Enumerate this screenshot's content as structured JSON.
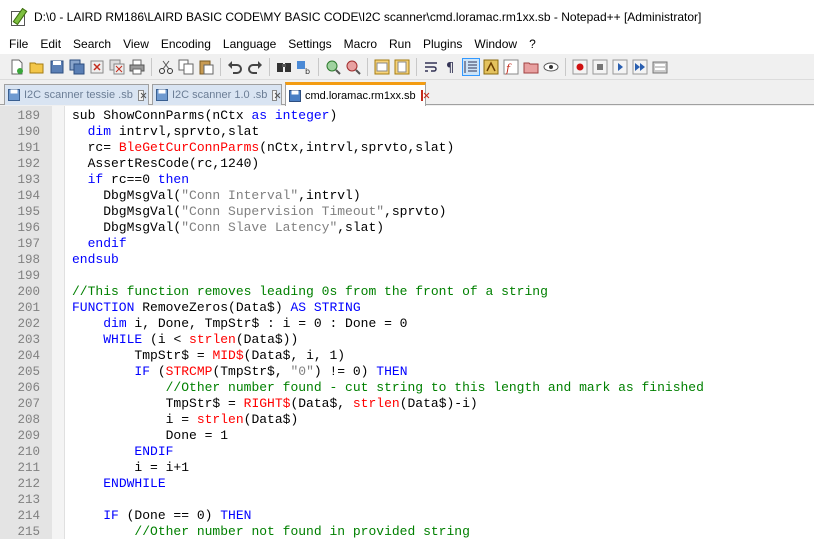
{
  "window": {
    "title": "D:\\0 - LAIRD RM186\\LAIRD BASIC CODE\\MY BASIC CODE\\I2C scanner\\cmd.loramac.rm1xx.sb - Notepad++ [Administrator]"
  },
  "menu": [
    "File",
    "Edit",
    "Search",
    "View",
    "Encoding",
    "Language",
    "Settings",
    "Macro",
    "Run",
    "Plugins",
    "Window",
    "?"
  ],
  "toolbar": {
    "icons": [
      "new-file-icon",
      "open-file-icon",
      "save-icon",
      "save-all-icon",
      "close-icon",
      "close-all-icon",
      "print-icon",
      "cut-icon",
      "copy-icon",
      "paste-icon",
      "undo-icon",
      "redo-icon",
      "find-icon",
      "replace-icon",
      "zoom-in-icon",
      "zoom-out-icon",
      "sync-vertical-icon",
      "sync-horizontal-icon",
      "word-wrap-icon",
      "show-all-characters-icon",
      "indent-guide-icon",
      "user-defined-language-icon",
      "function-list-icon",
      "folder-as-workspace-icon",
      "document-map-icon",
      "monitoring-icon",
      "record-macro-icon",
      "stop-recording-icon",
      "play-macro-icon",
      "run-macro-multiple-icon",
      "save-macro-icon"
    ]
  },
  "tabs": [
    {
      "label": "I2C scanner tessie .sb",
      "active": false
    },
    {
      "label": "I2C scanner 1.0 .sb",
      "active": false
    },
    {
      "label": "cmd.loramac.rm1xx.sb",
      "active": true
    }
  ],
  "editor": {
    "lines": [
      {
        "n": "189",
        "segs": [
          [
            "",
            "sub ShowConnParms(nCtx "
          ],
          [
            "kw",
            "as"
          ],
          [
            "",
            " "
          ],
          [
            "kw",
            "integer"
          ],
          [
            "",
            ")"
          ]
        ]
      },
      {
        "n": "190",
        "segs": [
          [
            "",
            "  "
          ],
          [
            "kw",
            "dim"
          ],
          [
            "",
            " intrvl,sprvto,slat"
          ]
        ]
      },
      {
        "n": "191",
        "segs": [
          [
            "",
            "  rc= "
          ],
          [
            "fn",
            "BleGetCurConnParms"
          ],
          [
            "",
            "(nCtx,intrvl,sprvto,slat)"
          ]
        ]
      },
      {
        "n": "192",
        "segs": [
          [
            "",
            "  AssertResCode(rc,1240)"
          ]
        ]
      },
      {
        "n": "193",
        "segs": [
          [
            "",
            "  "
          ],
          [
            "kw",
            "if"
          ],
          [
            "",
            " rc==0 "
          ],
          [
            "kw",
            "then"
          ]
        ]
      },
      {
        "n": "194",
        "segs": [
          [
            "",
            "    DbgMsgVal("
          ],
          [
            "str",
            "\"Conn Interval\""
          ],
          [
            "",
            ",intrvl)"
          ]
        ]
      },
      {
        "n": "195",
        "segs": [
          [
            "",
            "    DbgMsgVal("
          ],
          [
            "str",
            "\"Conn Supervision Timeout\""
          ],
          [
            "",
            ",sprvto)"
          ]
        ]
      },
      {
        "n": "196",
        "segs": [
          [
            "",
            "    DbgMsgVal("
          ],
          [
            "str",
            "\"Conn Slave Latency\""
          ],
          [
            "",
            ",slat)"
          ]
        ]
      },
      {
        "n": "197",
        "segs": [
          [
            "",
            "  "
          ],
          [
            "kw",
            "endif"
          ]
        ]
      },
      {
        "n": "198",
        "segs": [
          [
            "kw",
            "endsub"
          ]
        ]
      },
      {
        "n": "199",
        "segs": []
      },
      {
        "n": "200",
        "segs": [
          [
            "cm",
            "//This function removes leading 0s from the front of a string"
          ]
        ]
      },
      {
        "n": "201",
        "segs": [
          [
            "kw",
            "FUNCTION"
          ],
          [
            "",
            " RemoveZeros(Data$) "
          ],
          [
            "kw",
            "AS STRING"
          ]
        ]
      },
      {
        "n": "202",
        "segs": [
          [
            "",
            "    "
          ],
          [
            "kw",
            "dim"
          ],
          [
            "",
            " i, Done, TmpStr$ : i = 0 : Done = 0"
          ]
        ]
      },
      {
        "n": "203",
        "segs": [
          [
            "",
            "    "
          ],
          [
            "kw",
            "WHILE"
          ],
          [
            "",
            " (i < "
          ],
          [
            "fn",
            "strlen"
          ],
          [
            "",
            "(Data$))"
          ]
        ]
      },
      {
        "n": "204",
        "segs": [
          [
            "",
            "        TmpStr$ = "
          ],
          [
            "fn",
            "MID$"
          ],
          [
            "",
            "(Data$, i, 1)"
          ]
        ]
      },
      {
        "n": "205",
        "segs": [
          [
            "",
            "        "
          ],
          [
            "kw",
            "IF"
          ],
          [
            "",
            " ("
          ],
          [
            "fn",
            "STRCMP"
          ],
          [
            "",
            "(TmpStr$, "
          ],
          [
            "str",
            "\"0\""
          ],
          [
            "",
            ") != 0) "
          ],
          [
            "kw",
            "THEN"
          ]
        ]
      },
      {
        "n": "206",
        "segs": [
          [
            "",
            "            "
          ],
          [
            "cm",
            "//Other number found - cut string to this length and mark as finished"
          ]
        ]
      },
      {
        "n": "207",
        "segs": [
          [
            "",
            "            TmpStr$ = "
          ],
          [
            "fn",
            "RIGHT$"
          ],
          [
            "",
            "(Data$, "
          ],
          [
            "fn",
            "strlen"
          ],
          [
            "",
            "(Data$)-i)"
          ]
        ]
      },
      {
        "n": "208",
        "segs": [
          [
            "",
            "            i = "
          ],
          [
            "fn",
            "strlen"
          ],
          [
            "",
            "(Data$)"
          ]
        ]
      },
      {
        "n": "209",
        "segs": [
          [
            "",
            "            Done = 1"
          ]
        ]
      },
      {
        "n": "210",
        "segs": [
          [
            "",
            "        "
          ],
          [
            "kw",
            "ENDIF"
          ]
        ]
      },
      {
        "n": "211",
        "segs": [
          [
            "",
            "        i = i+1"
          ]
        ]
      },
      {
        "n": "212",
        "segs": [
          [
            "",
            "    "
          ],
          [
            "kw",
            "ENDWHILE"
          ]
        ]
      },
      {
        "n": "213",
        "segs": []
      },
      {
        "n": "214",
        "segs": [
          [
            "",
            "    "
          ],
          [
            "kw",
            "IF"
          ],
          [
            "",
            " (Done == 0) "
          ],
          [
            "kw",
            "THEN"
          ]
        ]
      },
      {
        "n": "215",
        "segs": [
          [
            "",
            "        "
          ],
          [
            "cm",
            "//Other number not found in provided string"
          ]
        ]
      }
    ]
  }
}
